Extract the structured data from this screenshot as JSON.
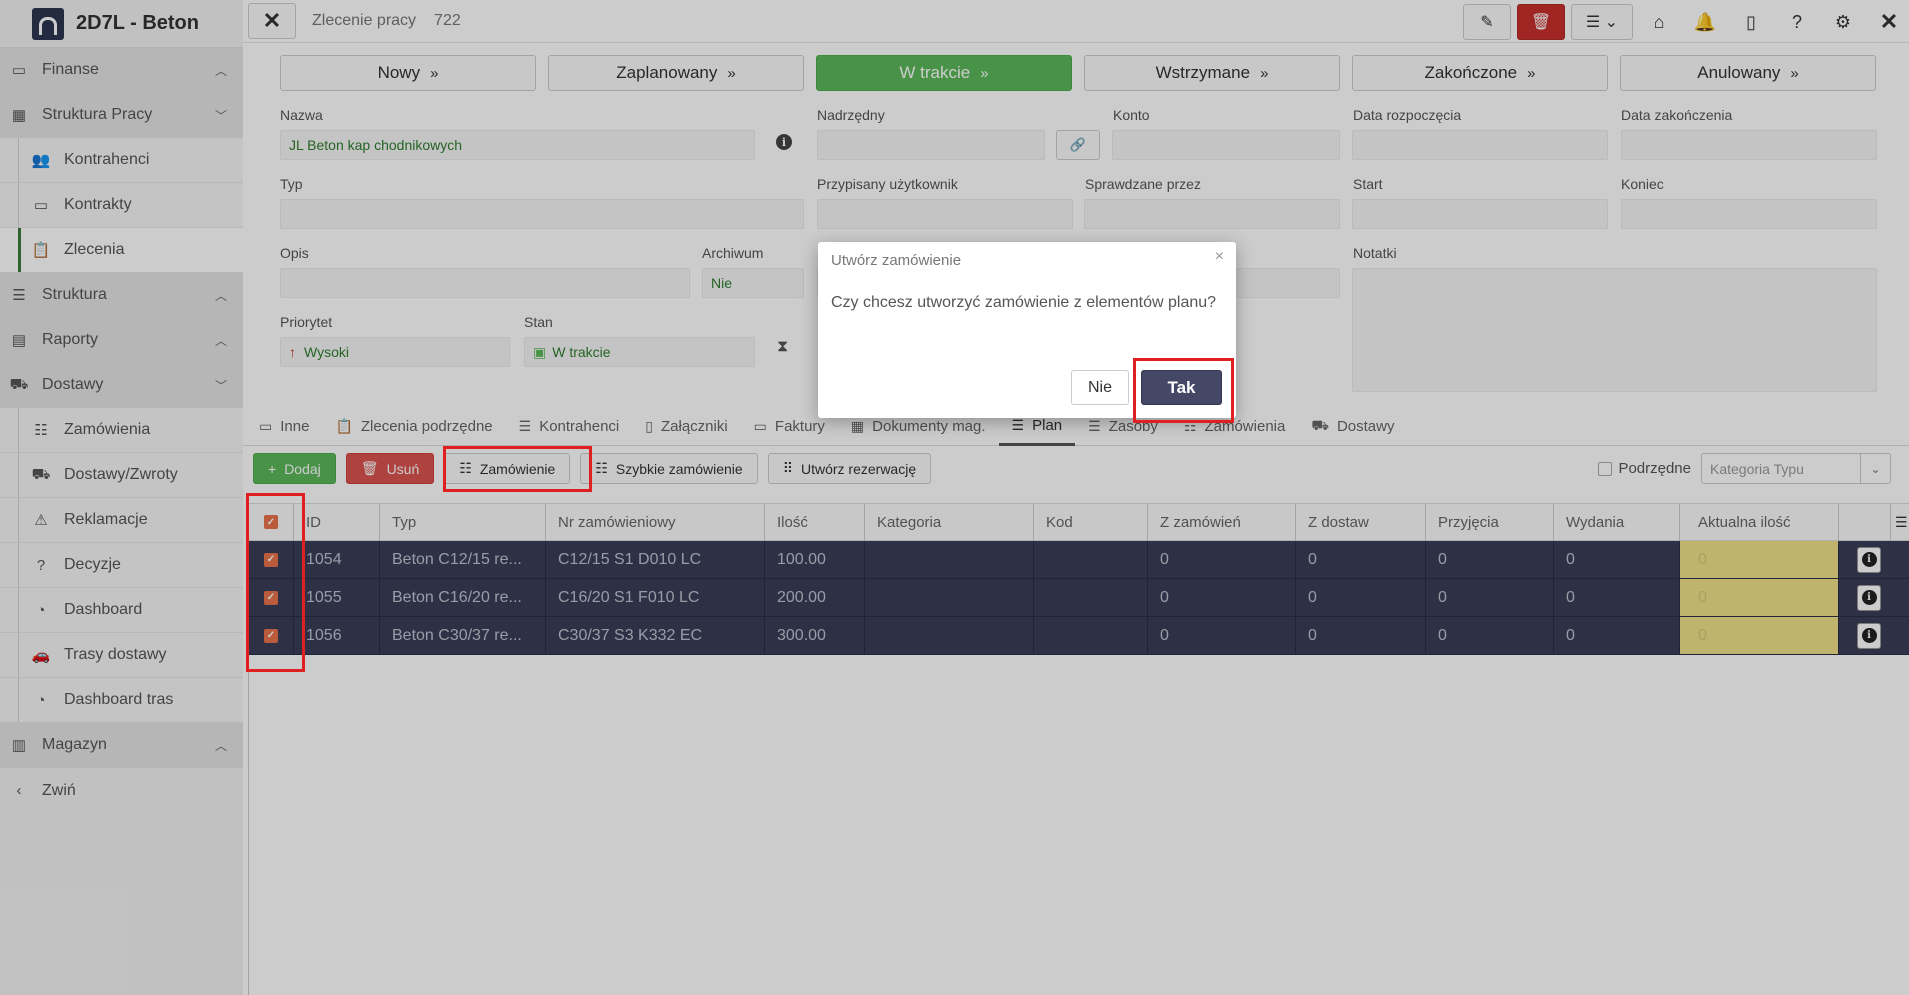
{
  "app": {
    "title": "2D7L - Beton"
  },
  "sidebar": {
    "items": [
      {
        "label": "Finanse",
        "icon": "money-icon",
        "level": "top",
        "chevron": "up"
      },
      {
        "label": "Struktura Pracy",
        "icon": "building-icon",
        "level": "top",
        "chevron": "down"
      },
      {
        "label": "Kontrahenci",
        "icon": "users-icon",
        "level": "sub"
      },
      {
        "label": "Kontrakty",
        "icon": "money-icon",
        "level": "sub"
      },
      {
        "label": "Zlecenia",
        "icon": "clipboard-icon",
        "level": "sub",
        "active": true
      },
      {
        "label": "Struktura",
        "icon": "hierarchy-icon",
        "level": "top",
        "chevron": "up"
      },
      {
        "label": "Raporty",
        "icon": "report-icon",
        "level": "top",
        "chevron": "up"
      },
      {
        "label": "Dostawy",
        "icon": "truck-icon",
        "level": "top",
        "chevron": "down"
      },
      {
        "label": "Zamówienia",
        "icon": "list-icon",
        "level": "sub"
      },
      {
        "label": "Dostawy/Zwroty",
        "icon": "truck-icon",
        "level": "sub"
      },
      {
        "label": "Reklamacje",
        "icon": "warning-icon",
        "level": "sub"
      },
      {
        "label": "Decyzje",
        "icon": "question-icon",
        "level": "sub"
      },
      {
        "label": "Dashboard",
        "icon": "dashboard-icon",
        "level": "sub"
      },
      {
        "label": "Trasy dostawy",
        "icon": "car-icon",
        "level": "sub"
      },
      {
        "label": "Dashboard tras",
        "icon": "dashboard-icon",
        "level": "sub"
      },
      {
        "label": "Magazyn",
        "icon": "warehouse-icon",
        "level": "top",
        "chevron": "up"
      },
      {
        "label": "Zwiń",
        "icon": "chevron-left-icon",
        "level": "top"
      }
    ]
  },
  "header": {
    "breadcrumb": "Zlecenie pracy",
    "record_id": "722"
  },
  "stages": [
    {
      "label": "Nowy",
      "active": false
    },
    {
      "label": "Zaplanowany",
      "active": false
    },
    {
      "label": "W trakcie",
      "active": true
    },
    {
      "label": "Wstrzymane",
      "active": false
    },
    {
      "label": "Zakończone",
      "active": false
    },
    {
      "label": "Anulowany",
      "active": false
    }
  ],
  "form": {
    "nazwa_label": "Nazwa",
    "nazwa_value": "JL Beton kap chodnikowych",
    "nadrzedny_label": "Nadrzędny",
    "konto_label": "Konto",
    "data_rozp_label": "Data rozpoczęcia",
    "data_zak_label": "Data zakończenia",
    "typ_label": "Typ",
    "przypisany_label": "Przypisany użytkownik",
    "sprawdzane_label": "Sprawdzane przez",
    "start_label": "Start",
    "koniec_label": "Koniec",
    "opis_label": "Opis",
    "archiwum_label": "Archiwum",
    "archiwum_value": "Nie",
    "notatki_label": "Notatki",
    "priorytet_label": "Priorytet",
    "priorytet_value": "Wysoki",
    "stan_label": "Stan",
    "stan_value": "W trakcie"
  },
  "tabs": [
    {
      "label": "Inne",
      "icon": "folder-icon"
    },
    {
      "label": "Zlecenia podrzędne",
      "icon": "clipboard-icon"
    },
    {
      "label": "Kontrahenci",
      "icon": "list-icon"
    },
    {
      "label": "Załączniki",
      "icon": "file-icon"
    },
    {
      "label": "Faktury",
      "icon": "money-icon"
    },
    {
      "label": "Dokumenty mag.",
      "icon": "grid-icon"
    },
    {
      "label": "Plan",
      "icon": "list-icon",
      "active": true
    },
    {
      "label": "Zasoby",
      "icon": "list-icon"
    },
    {
      "label": "Zamówienia",
      "icon": "list-icon"
    },
    {
      "label": "Dostawy",
      "icon": "truck-icon"
    }
  ],
  "toolbar": {
    "add_label": "Dodaj",
    "delete_label": "Usuń",
    "order_label": "Zamówienie",
    "quick_order_label": "Szybkie zamówienie",
    "reservation_label": "Utwórz rezerwację",
    "subordinate_label": "Podrzędne",
    "category_placeholder": "Kategoria Typu"
  },
  "grid": {
    "columns": [
      "ID",
      "Typ",
      "Nr zamówieniowy",
      "Ilość",
      "Kategoria",
      "Kod",
      "Z zamówień",
      "Z dostaw",
      "Przyjęcia",
      "Wydania",
      "Aktualna ilość"
    ],
    "rows": [
      {
        "id": "1054",
        "typ": "Beton C12/15 re...",
        "nr": "C12/15 S1 D010 LC",
        "ilosc": "100.00",
        "kategoria": "",
        "kod": "",
        "z_zam": "0",
        "z_dost": "0",
        "przyj": "0",
        "wyd": "0",
        "akt": "0"
      },
      {
        "id": "1055",
        "typ": "Beton C16/20 re...",
        "nr": "C16/20 S1 F010 LC",
        "ilosc": "200.00",
        "kategoria": "",
        "kod": "",
        "z_zam": "0",
        "z_dost": "0",
        "przyj": "0",
        "wyd": "0",
        "akt": "0"
      },
      {
        "id": "1056",
        "typ": "Beton C30/37 re...",
        "nr": "C30/37 S3 K332 EC",
        "ilosc": "300.00",
        "kategoria": "",
        "kod": "",
        "z_zam": "0",
        "z_dost": "0",
        "przyj": "0",
        "wyd": "0",
        "akt": "0"
      }
    ]
  },
  "modal": {
    "title": "Utwórz zamówienie",
    "message": "Czy chcesz utworzyć zamówienie z elementów planu?",
    "no_label": "Nie",
    "yes_label": "Tak"
  },
  "colors": {
    "active_stage": "#5cb85c",
    "row_bg": "#3a3e58",
    "highlight": "#e02020",
    "yes_button": "#444766"
  }
}
